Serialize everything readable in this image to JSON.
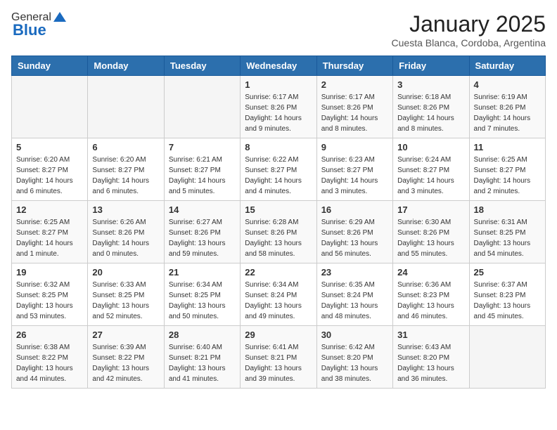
{
  "logo": {
    "general": "General",
    "blue": "Blue"
  },
  "title": "January 2025",
  "location": "Cuesta Blanca, Cordoba, Argentina",
  "days_of_week": [
    "Sunday",
    "Monday",
    "Tuesday",
    "Wednesday",
    "Thursday",
    "Friday",
    "Saturday"
  ],
  "weeks": [
    [
      {
        "day": null,
        "info": null
      },
      {
        "day": null,
        "info": null
      },
      {
        "day": null,
        "info": null
      },
      {
        "day": "1",
        "sunrise": "Sunrise: 6:17 AM",
        "sunset": "Sunset: 8:26 PM",
        "daylight": "Daylight: 14 hours and 9 minutes."
      },
      {
        "day": "2",
        "sunrise": "Sunrise: 6:17 AM",
        "sunset": "Sunset: 8:26 PM",
        "daylight": "Daylight: 14 hours and 8 minutes."
      },
      {
        "day": "3",
        "sunrise": "Sunrise: 6:18 AM",
        "sunset": "Sunset: 8:26 PM",
        "daylight": "Daylight: 14 hours and 8 minutes."
      },
      {
        "day": "4",
        "sunrise": "Sunrise: 6:19 AM",
        "sunset": "Sunset: 8:26 PM",
        "daylight": "Daylight: 14 hours and 7 minutes."
      }
    ],
    [
      {
        "day": "5",
        "sunrise": "Sunrise: 6:20 AM",
        "sunset": "Sunset: 8:27 PM",
        "daylight": "Daylight: 14 hours and 6 minutes."
      },
      {
        "day": "6",
        "sunrise": "Sunrise: 6:20 AM",
        "sunset": "Sunset: 8:27 PM",
        "daylight": "Daylight: 14 hours and 6 minutes."
      },
      {
        "day": "7",
        "sunrise": "Sunrise: 6:21 AM",
        "sunset": "Sunset: 8:27 PM",
        "daylight": "Daylight: 14 hours and 5 minutes."
      },
      {
        "day": "8",
        "sunrise": "Sunrise: 6:22 AM",
        "sunset": "Sunset: 8:27 PM",
        "daylight": "Daylight: 14 hours and 4 minutes."
      },
      {
        "day": "9",
        "sunrise": "Sunrise: 6:23 AM",
        "sunset": "Sunset: 8:27 PM",
        "daylight": "Daylight: 14 hours and 3 minutes."
      },
      {
        "day": "10",
        "sunrise": "Sunrise: 6:24 AM",
        "sunset": "Sunset: 8:27 PM",
        "daylight": "Daylight: 14 hours and 3 minutes."
      },
      {
        "day": "11",
        "sunrise": "Sunrise: 6:25 AM",
        "sunset": "Sunset: 8:27 PM",
        "daylight": "Daylight: 14 hours and 2 minutes."
      }
    ],
    [
      {
        "day": "12",
        "sunrise": "Sunrise: 6:25 AM",
        "sunset": "Sunset: 8:27 PM",
        "daylight": "Daylight: 14 hours and 1 minute."
      },
      {
        "day": "13",
        "sunrise": "Sunrise: 6:26 AM",
        "sunset": "Sunset: 8:26 PM",
        "daylight": "Daylight: 14 hours and 0 minutes."
      },
      {
        "day": "14",
        "sunrise": "Sunrise: 6:27 AM",
        "sunset": "Sunset: 8:26 PM",
        "daylight": "Daylight: 13 hours and 59 minutes."
      },
      {
        "day": "15",
        "sunrise": "Sunrise: 6:28 AM",
        "sunset": "Sunset: 8:26 PM",
        "daylight": "Daylight: 13 hours and 58 minutes."
      },
      {
        "day": "16",
        "sunrise": "Sunrise: 6:29 AM",
        "sunset": "Sunset: 8:26 PM",
        "daylight": "Daylight: 13 hours and 56 minutes."
      },
      {
        "day": "17",
        "sunrise": "Sunrise: 6:30 AM",
        "sunset": "Sunset: 8:26 PM",
        "daylight": "Daylight: 13 hours and 55 minutes."
      },
      {
        "day": "18",
        "sunrise": "Sunrise: 6:31 AM",
        "sunset": "Sunset: 8:25 PM",
        "daylight": "Daylight: 13 hours and 54 minutes."
      }
    ],
    [
      {
        "day": "19",
        "sunrise": "Sunrise: 6:32 AM",
        "sunset": "Sunset: 8:25 PM",
        "daylight": "Daylight: 13 hours and 53 minutes."
      },
      {
        "day": "20",
        "sunrise": "Sunrise: 6:33 AM",
        "sunset": "Sunset: 8:25 PM",
        "daylight": "Daylight: 13 hours and 52 minutes."
      },
      {
        "day": "21",
        "sunrise": "Sunrise: 6:34 AM",
        "sunset": "Sunset: 8:25 PM",
        "daylight": "Daylight: 13 hours and 50 minutes."
      },
      {
        "day": "22",
        "sunrise": "Sunrise: 6:34 AM",
        "sunset": "Sunset: 8:24 PM",
        "daylight": "Daylight: 13 hours and 49 minutes."
      },
      {
        "day": "23",
        "sunrise": "Sunrise: 6:35 AM",
        "sunset": "Sunset: 8:24 PM",
        "daylight": "Daylight: 13 hours and 48 minutes."
      },
      {
        "day": "24",
        "sunrise": "Sunrise: 6:36 AM",
        "sunset": "Sunset: 8:23 PM",
        "daylight": "Daylight: 13 hours and 46 minutes."
      },
      {
        "day": "25",
        "sunrise": "Sunrise: 6:37 AM",
        "sunset": "Sunset: 8:23 PM",
        "daylight": "Daylight: 13 hours and 45 minutes."
      }
    ],
    [
      {
        "day": "26",
        "sunrise": "Sunrise: 6:38 AM",
        "sunset": "Sunset: 8:22 PM",
        "daylight": "Daylight: 13 hours and 44 minutes."
      },
      {
        "day": "27",
        "sunrise": "Sunrise: 6:39 AM",
        "sunset": "Sunset: 8:22 PM",
        "daylight": "Daylight: 13 hours and 42 minutes."
      },
      {
        "day": "28",
        "sunrise": "Sunrise: 6:40 AM",
        "sunset": "Sunset: 8:21 PM",
        "daylight": "Daylight: 13 hours and 41 minutes."
      },
      {
        "day": "29",
        "sunrise": "Sunrise: 6:41 AM",
        "sunset": "Sunset: 8:21 PM",
        "daylight": "Daylight: 13 hours and 39 minutes."
      },
      {
        "day": "30",
        "sunrise": "Sunrise: 6:42 AM",
        "sunset": "Sunset: 8:20 PM",
        "daylight": "Daylight: 13 hours and 38 minutes."
      },
      {
        "day": "31",
        "sunrise": "Sunrise: 6:43 AM",
        "sunset": "Sunset: 8:20 PM",
        "daylight": "Daylight: 13 hours and 36 minutes."
      },
      {
        "day": null,
        "info": null
      }
    ]
  ]
}
